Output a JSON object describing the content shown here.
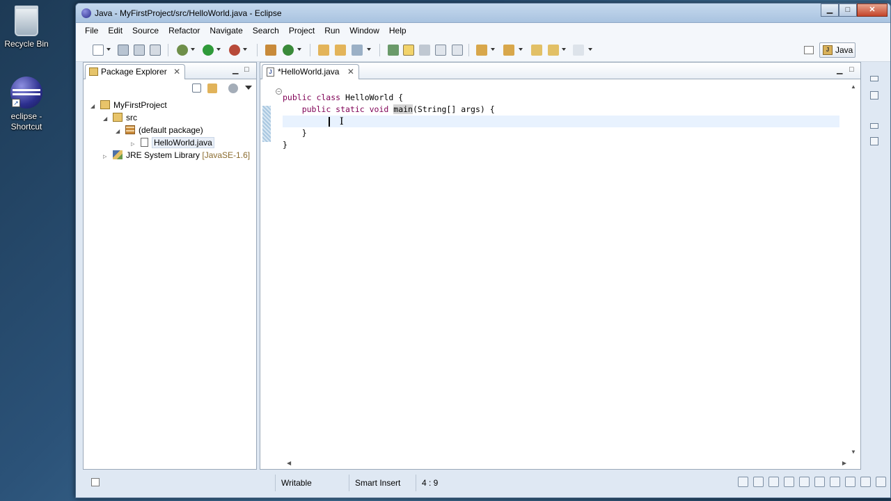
{
  "desktop": {
    "recycle_bin": "Recycle Bin",
    "eclipse_shortcut": "eclipse -\nShortcut"
  },
  "window": {
    "title": "Java - MyFirstProject/src/HelloWorld.java - Eclipse",
    "buttons": {
      "minimize": "▁",
      "maximize": "□",
      "close": "✕"
    }
  },
  "menu": [
    "File",
    "Edit",
    "Source",
    "Refactor",
    "Navigate",
    "Search",
    "Project",
    "Run",
    "Window",
    "Help"
  ],
  "perspective": {
    "label": "Java"
  },
  "package_explorer": {
    "tab_label": "Package Explorer",
    "tree": [
      {
        "label": "MyFirstProject",
        "level": 0,
        "icon": "project-icon"
      },
      {
        "label": "src",
        "level": 1,
        "icon": "source-folder-icon"
      },
      {
        "label": "(default package)",
        "level": 2,
        "icon": "package-icon"
      },
      {
        "label": "HelloWorld.java",
        "level": 3,
        "icon": "java-file-icon",
        "selected": true
      },
      {
        "label": "JRE System Library",
        "suffix": "[JavaSE-1.6]",
        "level": 1,
        "icon": "library-icon"
      }
    ]
  },
  "editor": {
    "tab_label": "*HelloWorld.java",
    "code": {
      "l1": {
        "kw": "public class",
        "rest": " HelloWorld {"
      },
      "l2": {
        "indent": "    ",
        "kw": "public static void",
        "sp": " ",
        "method": "main",
        "rest": "(String[] args) {"
      },
      "l4": "    }",
      "l5": "}"
    },
    "cursor": {
      "line": 4,
      "column": 9
    }
  },
  "status": {
    "writable": "Writable",
    "insert_mode": "Smart Insert",
    "position": "4 : 9"
  },
  "colors": {
    "keyword": "#7f0055",
    "current_line": "#e8f2fe"
  }
}
